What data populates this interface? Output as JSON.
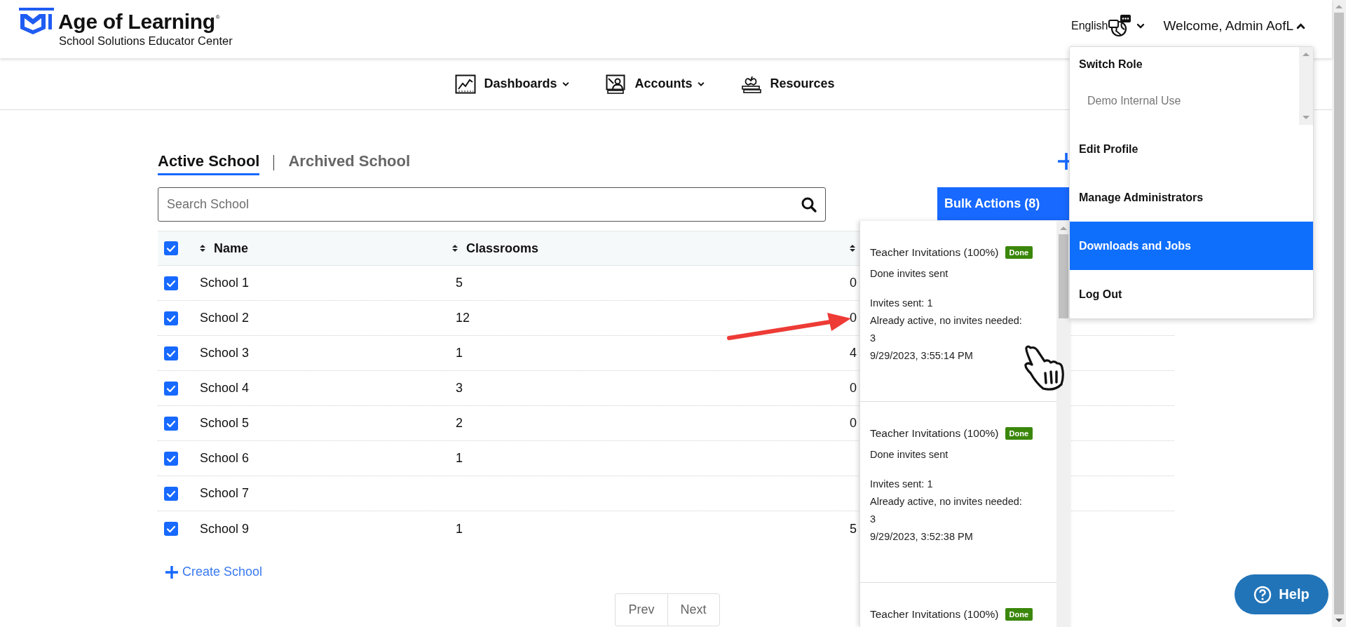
{
  "header": {
    "brand": "Age of Learning",
    "brand_mark": "®",
    "subtitle": "School Solutions Educator Center",
    "language": "English",
    "welcome": "Welcome, Admin AofL",
    "user_menu_expanded": true
  },
  "nav": [
    {
      "label": "Dashboards",
      "has_dropdown": true
    },
    {
      "label": "Accounts",
      "has_dropdown": true
    },
    {
      "label": "Resources",
      "has_dropdown": false
    }
  ],
  "tabs": [
    {
      "label": "Active School",
      "selected": true
    },
    {
      "label": "Archived School",
      "selected": false
    }
  ],
  "search": {
    "placeholder": "Search School"
  },
  "bulk_actions": {
    "label": "Bulk Actions (8)"
  },
  "table": {
    "select_all_checked": true,
    "columns": [
      {
        "label": "Name",
        "sortable": true
      },
      {
        "label": "Classrooms",
        "sortable": true
      },
      {
        "sortable": true
      }
    ],
    "rows": [
      {
        "checked": true,
        "name": "School 1",
        "classrooms": "5",
        "column_3": "0"
      },
      {
        "checked": true,
        "name": "School 2",
        "classrooms": "12",
        "column_3": "0"
      },
      {
        "checked": true,
        "name": "School 3",
        "classrooms": "1",
        "column_3": "4"
      },
      {
        "checked": true,
        "name": "School 4",
        "classrooms": "3",
        "column_3": "0"
      },
      {
        "checked": true,
        "name": "School 5",
        "classrooms": "2",
        "column_3": "0"
      },
      {
        "checked": true,
        "name": "School 6",
        "classrooms": "1"
      },
      {
        "checked": true,
        "name": "School 7"
      },
      {
        "checked": true,
        "name": "School 9",
        "classrooms": "1",
        "column_3": "5"
      }
    ]
  },
  "create_school": "Create School",
  "pagination": [
    "Prev",
    "Next"
  ],
  "jobs": [
    {
      "title": "Teacher Invitations (100%)",
      "badge": "Done",
      "message": "Done invites sent",
      "details": [
        "Invites sent: 1",
        "Already active, no invites needed: 3",
        "9/29/2023, 3:55:14 PM"
      ]
    },
    {
      "title": "Teacher Invitations (100%)",
      "badge": "Done",
      "message": "Done invites sent",
      "details": [
        "Invites sent: 1",
        "Already active, no invites needed: 3",
        "9/29/2023, 3:52:38 PM"
      ]
    },
    {
      "title": "Teacher Invitations (100%)",
      "badge": "Done"
    }
  ],
  "user_menu": [
    {
      "kind": "heading",
      "label": "Switch Role"
    },
    {
      "kind": "listbox",
      "options": [
        "Demo Internal Use"
      ]
    },
    {
      "kind": "item",
      "label": "Edit Profile",
      "selected": false
    },
    {
      "kind": "item",
      "label": "Manage Administrators",
      "selected": false
    },
    {
      "kind": "item",
      "label": "Downloads and Jobs",
      "selected": true
    },
    {
      "kind": "item",
      "label": "Log Out",
      "selected": false
    }
  ],
  "help": "Help"
}
